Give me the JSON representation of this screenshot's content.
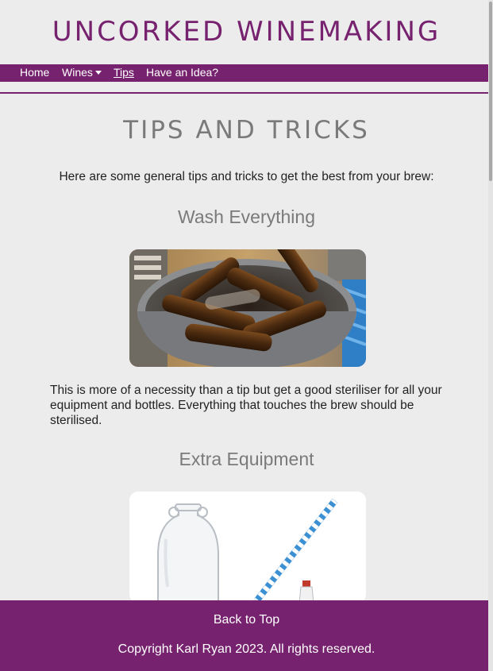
{
  "site": {
    "title": "UNCORKED WINEMAKING"
  },
  "nav": {
    "items": [
      {
        "label": "Home"
      },
      {
        "label": "Wines"
      },
      {
        "label": "Tips"
      },
      {
        "label": "Have an Idea?"
      }
    ],
    "dropdown_icon": "caret-down-icon",
    "active": "Tips"
  },
  "main": {
    "heading": "TIPS AND TRICKS",
    "intro": "Here are some general tips and tricks to get the best from your brew:",
    "sections": [
      {
        "heading": "Wash Everything",
        "text": "This is more of a necessity than a tip but get a good steriliser for all your equipment and bottles. Everything that touches the brew should be sterilised."
      },
      {
        "heading": "Extra Equipment"
      }
    ]
  },
  "footer": {
    "back_to_top": "Back to Top",
    "copyright": "Copyright Karl Ryan 2023. All rights reserved."
  },
  "colors": {
    "brand": "#76226f",
    "background": "#ececec",
    "heading_grey": "#7a7a7a"
  }
}
